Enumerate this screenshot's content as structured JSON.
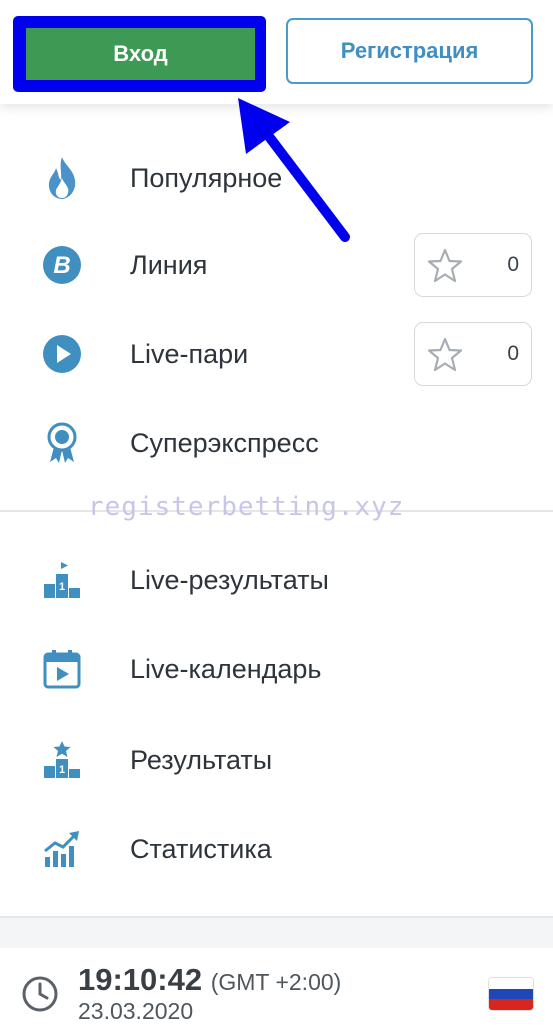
{
  "header": {
    "login_label": "Вход",
    "register_label": "Регистрация"
  },
  "menu": {
    "items": [
      {
        "label": "Популярное"
      },
      {
        "label": "Линия",
        "favorites_count": "0"
      },
      {
        "label": "Live-пари",
        "favorites_count": "0"
      },
      {
        "label": "Суперэкспресс"
      },
      {
        "label": "Live-результаты"
      },
      {
        "label": "Live-календарь"
      },
      {
        "label": "Результаты"
      },
      {
        "label": "Статистика"
      }
    ]
  },
  "watermark": "registerbetting.xyz",
  "footer": {
    "time": "19:10:42",
    "timezone": "(GMT +2:00)",
    "date": "23.03.2020"
  },
  "colors": {
    "accent_blue": "#3f8fc1",
    "login_green": "#3c9a54",
    "highlight_blue": "#0000ee"
  }
}
